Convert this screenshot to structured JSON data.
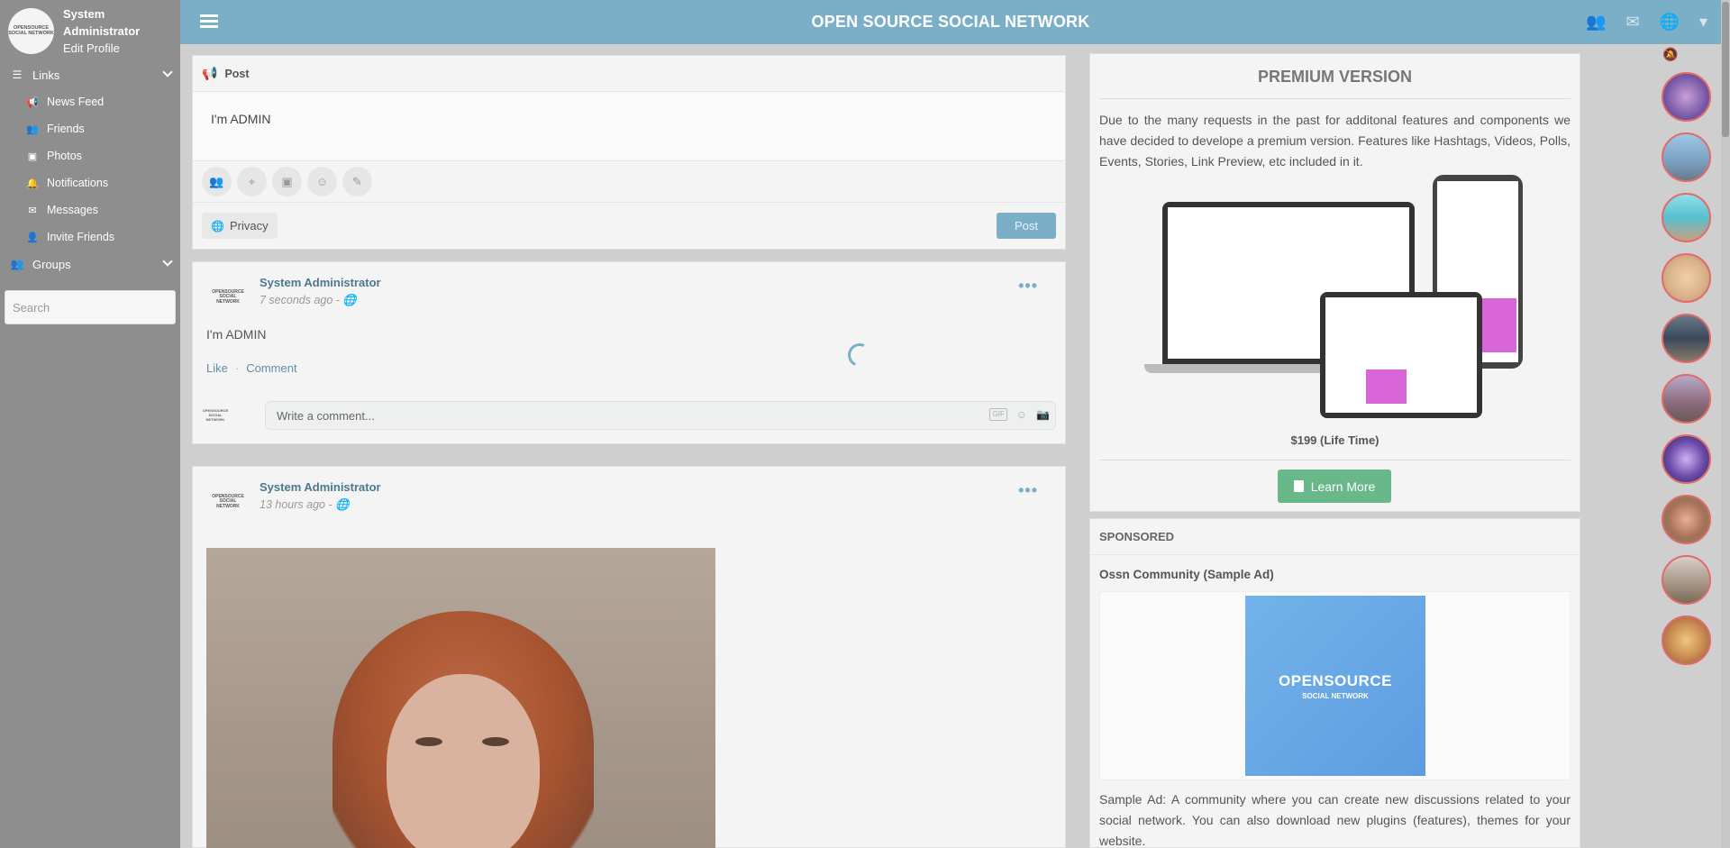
{
  "app": {
    "title": "OPEN SOURCE SOCIAL NETWORK"
  },
  "sidebar": {
    "profile_name": "System Administrator",
    "edit_profile": "Edit Profile",
    "logo_text": "OPENSOURCE SOCIAL NETWORK",
    "links_section": "Links",
    "items": [
      {
        "label": "News Feed",
        "icon": "megaphone-icon"
      },
      {
        "label": "Friends",
        "icon": "users-icon"
      },
      {
        "label": "Photos",
        "icon": "image-icon"
      },
      {
        "label": "Notifications",
        "icon": "bell-icon"
      },
      {
        "label": "Messages",
        "icon": "envelope-icon"
      },
      {
        "label": "Invite Friends",
        "icon": "user-plus-icon"
      }
    ],
    "groups_section": "Groups",
    "search_placeholder": "Search"
  },
  "composer": {
    "header": "Post",
    "text": "I'm ADMIN",
    "privacy": "Privacy",
    "post_button": "Post"
  },
  "posts": [
    {
      "author": "System Administrator",
      "time": "7 seconds ago",
      "text": "I'm ADMIN",
      "like": "Like",
      "comment": "Comment",
      "comment_placeholder": "Write a comment...",
      "gif": "GIF"
    },
    {
      "author": "System Administrator",
      "time": "13 hours ago"
    }
  ],
  "premium": {
    "title": "PREMIUM VERSION",
    "description": "Due to the many requests in the past for additonal features and components we have decided to develope a premium version. Features like Hashtags, Videos, Polls, Events, Stories, Link Preview, etc included in it.",
    "price": "$199 (Life Time)",
    "learn_more": "Learn More"
  },
  "sponsored": {
    "header": "SPONSORED",
    "title": "Ossn Community (Sample Ad)",
    "image_line1": "OPENSOURCE",
    "image_line2": "SOCIAL NETWORK",
    "description": "Sample Ad: A community where you can create new discussions related to your social network. You can also download new plugins (features), themes for your website."
  },
  "colors": {
    "topbar": "#7bafc8",
    "sidebar": "#8e8e8e",
    "learn_more": "#68b88a",
    "friend_ring": "#e36a6a"
  }
}
